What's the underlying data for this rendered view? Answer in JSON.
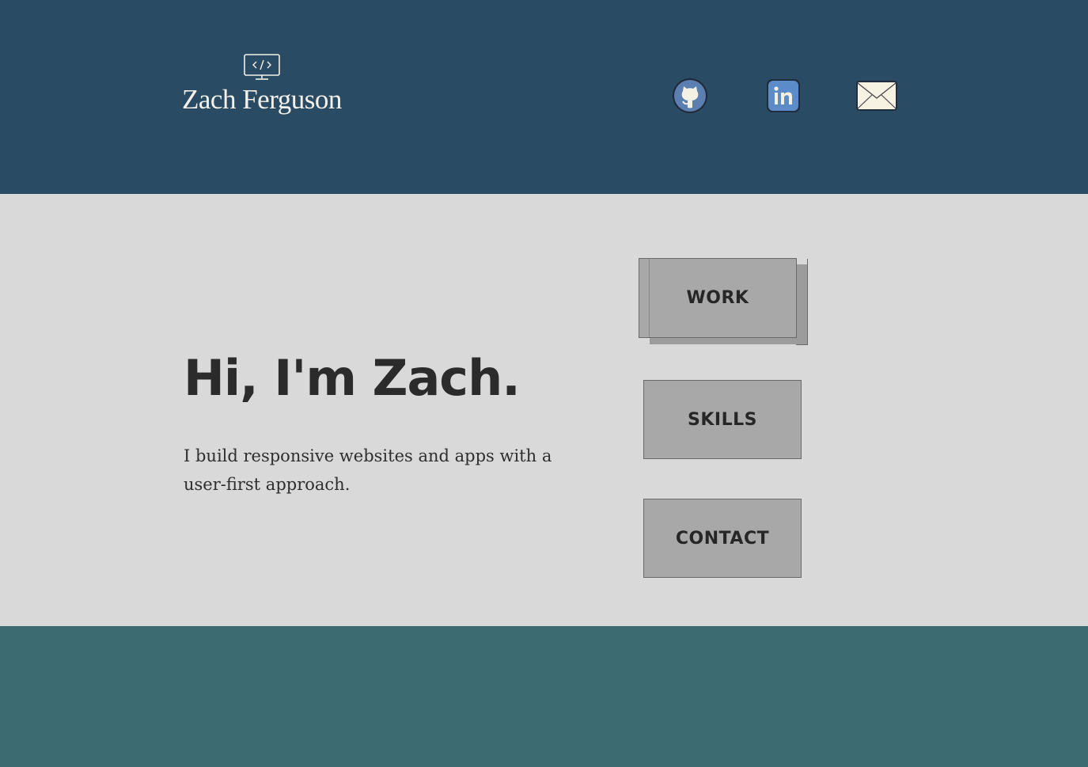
{
  "header": {
    "logo_icon": "code-monitor-icon",
    "logo_text": "Zach Ferguson",
    "social": [
      {
        "name": "github",
        "icon": "github-icon"
      },
      {
        "name": "linkedin",
        "icon": "linkedin-icon"
      },
      {
        "name": "email",
        "icon": "mail-icon"
      }
    ]
  },
  "hero": {
    "headline": "Hi, I'm Zach.",
    "tagline": "I build responsive websites and apps with a user-first approach.",
    "nav": {
      "work_label": "WORK",
      "skills_label": "SKILLS",
      "contact_label": "CONTACT"
    }
  },
  "colors": {
    "header_bg": "#294b64",
    "hero_bg": "#d9d9d9",
    "footer_bg": "#3c6c71",
    "button_bg": "#a8a8a8",
    "text_dark": "#2b2b2b"
  }
}
